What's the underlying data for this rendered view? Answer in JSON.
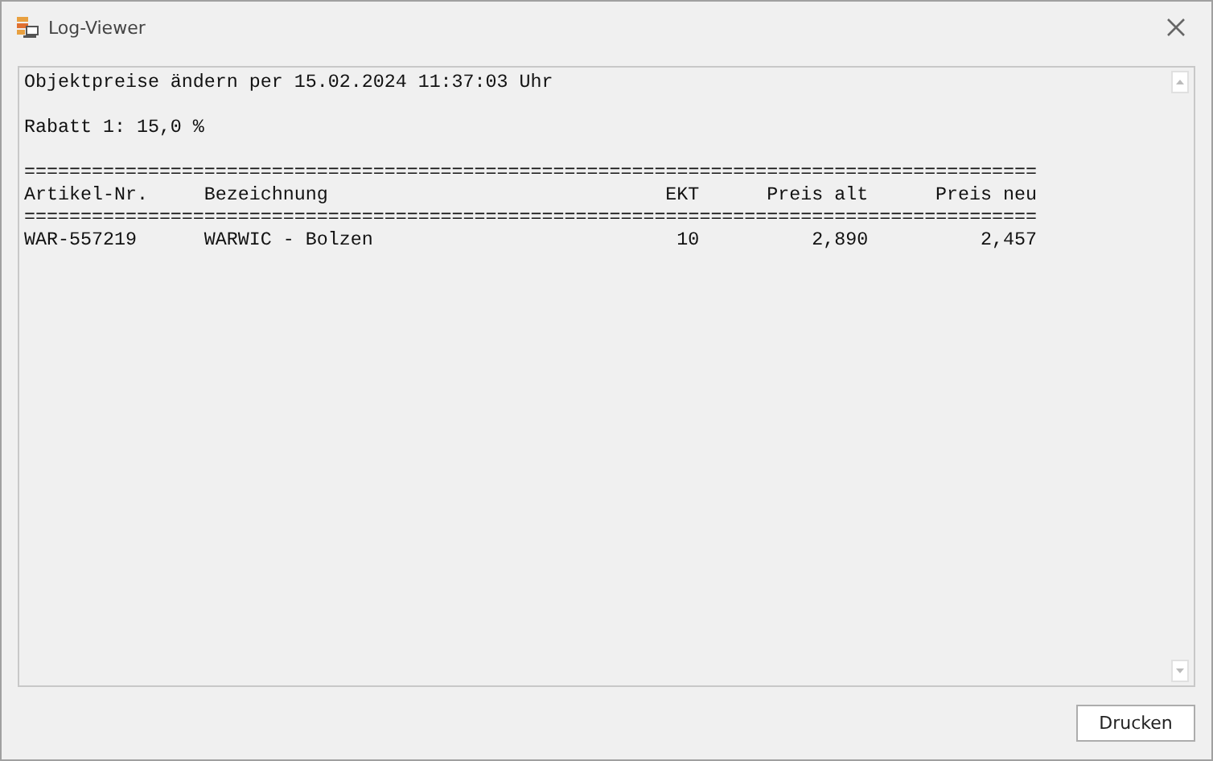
{
  "window": {
    "title": "Log-Viewer"
  },
  "log": {
    "lines": [
      "Objektpreise ändern per 15.02.2024 11:37:03 Uhr",
      "Rabatt 1: 15,0 %"
    ],
    "table": {
      "rule": "==========================================================================================",
      "columns": [
        "Artikel-Nr.",
        "Bezeichnung",
        "EKT",
        "Preis alt",
        "Preis neu"
      ],
      "rows": [
        [
          "WAR-557219",
          "WARWIC - Bolzen",
          "10",
          "2,890",
          "2,457"
        ]
      ]
    }
  },
  "buttons": [
    "Drucken"
  ]
}
